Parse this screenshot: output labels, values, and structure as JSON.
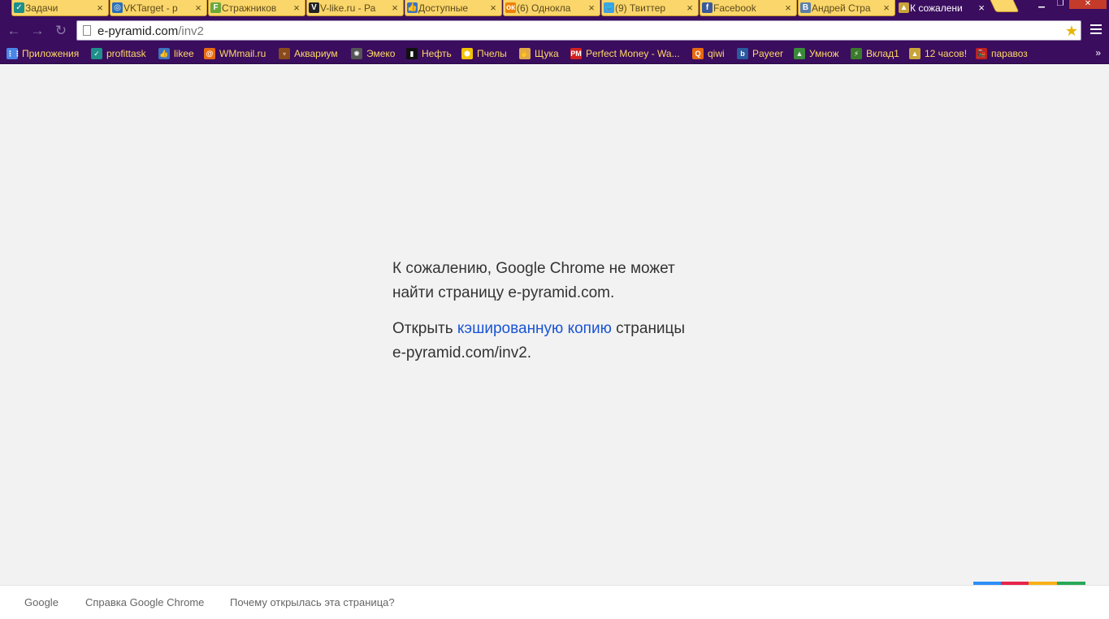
{
  "tabs": [
    {
      "title": "Задачи",
      "icon": "check-circle-icon",
      "color": "#1e8f8a",
      "glyph": "✓"
    },
    {
      "title": "VKTarget - р",
      "icon": "target-icon",
      "color": "#2a6fb8",
      "glyph": "◎"
    },
    {
      "title": "Стражников",
      "icon": "f-letter-icon",
      "color": "#6ba83a",
      "glyph": "F"
    },
    {
      "title": "V-like.ru - Ра",
      "icon": "v-letter-icon",
      "color": "#222222",
      "glyph": "V"
    },
    {
      "title": "Доступные",
      "icon": "thumbs-up-icon",
      "color": "#3b73c2",
      "glyph": "👍"
    },
    {
      "title": "(6) Однокла",
      "icon": "odnoklassniki-icon",
      "color": "#ee8208",
      "glyph": "ок"
    },
    {
      "title": "(9) Твиттер",
      "icon": "twitter-bird-icon",
      "color": "#3aa1e8",
      "glyph": "🐦"
    },
    {
      "title": "Facebook",
      "icon": "facebook-icon",
      "color": "#3b5998",
      "glyph": "f"
    },
    {
      "title": "Андрей Стра",
      "icon": "vk-icon",
      "color": "#5c7ea8",
      "glyph": "В"
    },
    {
      "title": "К сожалени",
      "icon": "pyramid-icon",
      "color": "#c9a43a",
      "glyph": "▲"
    }
  ],
  "window": {
    "minimize": "▁",
    "maximize": "❐",
    "close": "✕"
  },
  "omnibox": {
    "host": "e-pyramid.com",
    "path": "/inv2"
  },
  "bookmarks": [
    {
      "label": "Приложения",
      "icon": "apps-grid-icon",
      "color": "#4a86e8",
      "glyph": "⋮⋮"
    },
    {
      "label": "profittask",
      "icon": "check-circle-icon",
      "color": "#1e8f8a",
      "glyph": "✓"
    },
    {
      "label": "likee",
      "icon": "thumbs-up-icon",
      "color": "#3b73c2",
      "glyph": "👍"
    },
    {
      "label": "WMmail.ru",
      "icon": "at-sign-icon",
      "color": "#e86a10",
      "glyph": "@"
    },
    {
      "label": "Аквариум",
      "icon": "aquarium-icon",
      "color": "#8a4a1a",
      "glyph": "♆"
    },
    {
      "label": "Эмеко",
      "icon": "sun-icon",
      "color": "#555555",
      "glyph": "✺"
    },
    {
      "label": "Нефть",
      "icon": "oil-barrel-icon",
      "color": "#111111",
      "glyph": "▮"
    },
    {
      "label": "Пчелы",
      "icon": "hexagon-icon",
      "color": "#f2c200",
      "glyph": "⬢"
    },
    {
      "label": "Щука",
      "icon": "hand-icon",
      "color": "#e0a84a",
      "glyph": "✋"
    },
    {
      "label": "Perfect Money - Wa...",
      "icon": "perfect-money-icon",
      "color": "#d32020",
      "glyph": "PM"
    },
    {
      "label": "qiwi",
      "icon": "qiwi-icon",
      "color": "#e86a10",
      "glyph": "Q"
    },
    {
      "label": "Payeer",
      "icon": "payeer-icon",
      "color": "#2a5aa0",
      "glyph": "b"
    },
    {
      "label": "Умнож",
      "icon": "triangle-icon",
      "color": "#3a8a3a",
      "glyph": "▲"
    },
    {
      "label": "Вклад1",
      "icon": "lightning-icon",
      "color": "#3a7a2a",
      "glyph": "⚡"
    },
    {
      "label": "12 часов!",
      "icon": "pyramid-icon",
      "color": "#c9a43a",
      "glyph": "▲"
    },
    {
      "label": "паравоз",
      "icon": "train-icon",
      "color": "#c02020",
      "glyph": "🚂"
    }
  ],
  "error": {
    "line1": "К сожалению, Google Chrome не может",
    "line2": "найти страницу e-pyramid.com.",
    "open_prefix": "Открыть ",
    "cached_link": "кэшированную копию",
    "open_suffix": " страницы",
    "url_line": "e-pyramid.com/inv2."
  },
  "footer": {
    "google": "Google",
    "help": "Справка Google Chrome",
    "why": "Почему открылась эта страница?"
  },
  "google_bar_colors": [
    "#2c8ef8",
    "#e8244a",
    "#f8b018",
    "#2aa858"
  ]
}
